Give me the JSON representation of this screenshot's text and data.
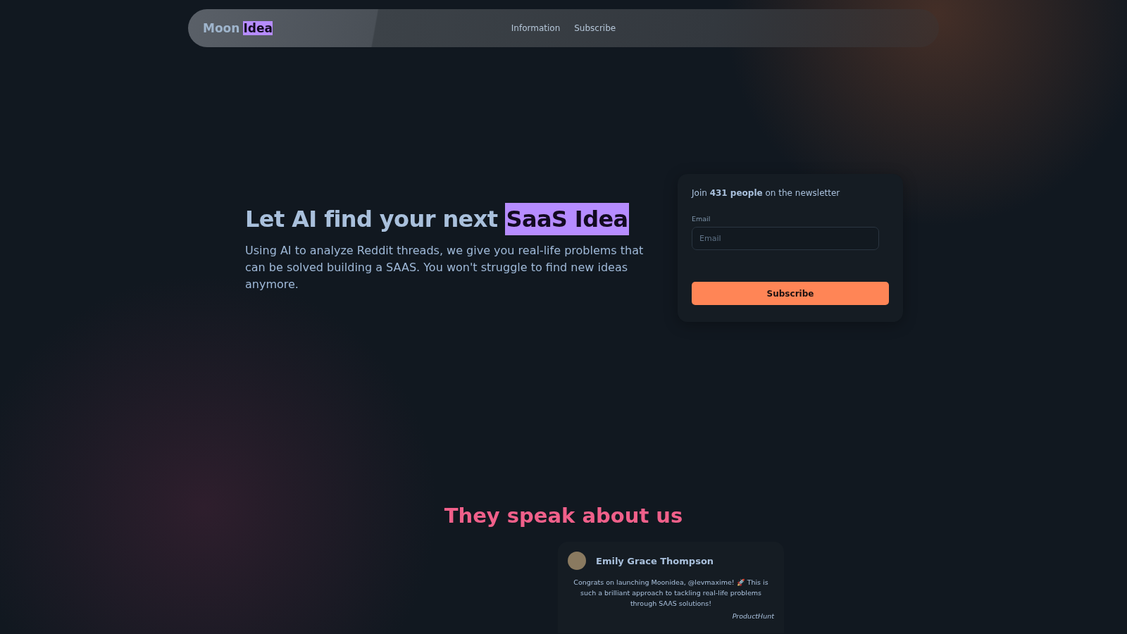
{
  "nav": {
    "logo": {
      "text": "Moon",
      "highlight": "Idea"
    },
    "links": [
      "Information",
      "Subscribe"
    ]
  },
  "hero": {
    "title": "Let AI find your next",
    "title_highlight": "SaaS Idea",
    "subtitle": "Using AI to analyze Reddit threads, we give you real-life problems that can be solved building a SAAS. You won't struggle to find new ideas anymore."
  },
  "newsletter": {
    "intro": "Join **431 people** on the newsletter",
    "email_label": "Email",
    "email_placeholder": "Email",
    "button": "Subscribe"
  },
  "testimonials": {
    "title": "They speak about us",
    "items": [
      {
        "name": "Emily Grace Thompson",
        "text": "Congrats on launching Moonidea, @levmaxime! 🚀 This is such a brilliant approach to tackling real-life problems through SAAS solutions!",
        "source": "ProductHunt"
      }
    ]
  }
}
